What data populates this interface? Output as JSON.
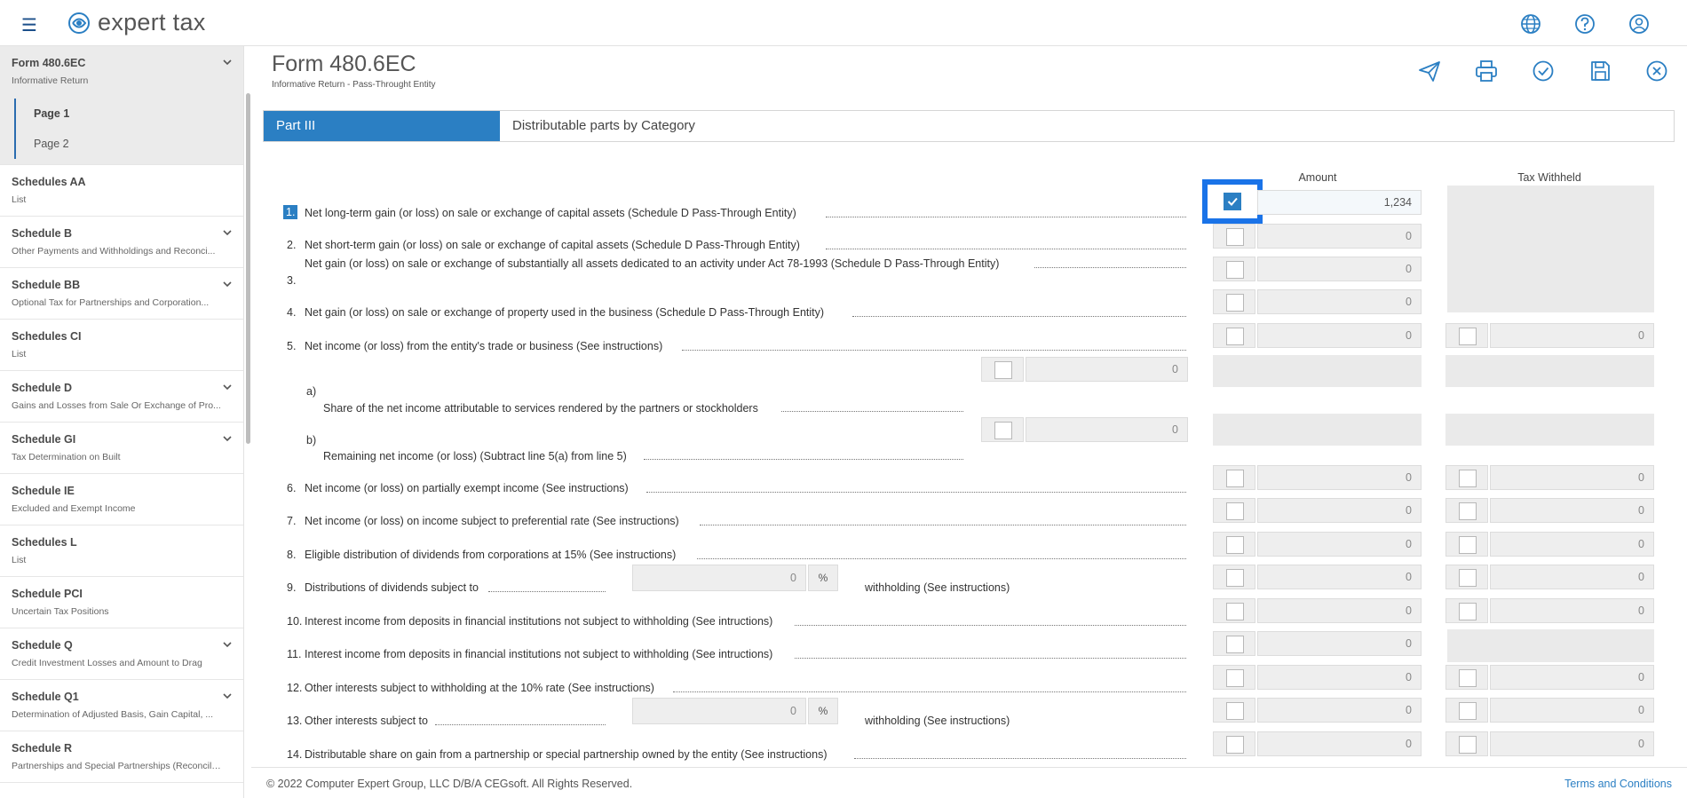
{
  "app": {
    "logo_text": "expert tax",
    "brand_color": "#2b7fc3",
    "focus_color": "#1a73e8"
  },
  "top_icons": [
    "globe-icon",
    "help-icon",
    "user-icon"
  ],
  "sidebar": {
    "items": [
      {
        "title": "Form 480.6EC",
        "sub": "Informative Return",
        "chevron": true,
        "active": true,
        "pages": [
          {
            "label": "Page 1",
            "active": true
          },
          {
            "label": "Page 2",
            "active": false
          }
        ]
      },
      {
        "title": "Schedules AA",
        "sub": "List",
        "chevron": false
      },
      {
        "title": "Schedule B",
        "sub": "Other Payments and Withholdings and Reconci...",
        "chevron": true
      },
      {
        "title": "Schedule BB",
        "sub": "Optional Tax for Partnerships and Corporation...",
        "chevron": true
      },
      {
        "title": "Schedules CI",
        "sub": "List",
        "chevron": false
      },
      {
        "title": "Schedule D",
        "sub": "Gains and Losses from Sale Or Exchange of Pro...",
        "chevron": true
      },
      {
        "title": "Schedule GI",
        "sub": "Tax Determination on Built",
        "chevron": true
      },
      {
        "title": "Schedule IE",
        "sub": "Excluded and Exempt Income",
        "chevron": false
      },
      {
        "title": "Schedules L",
        "sub": "List",
        "chevron": false
      },
      {
        "title": "Schedule PCI",
        "sub": "Uncertain Tax Positions",
        "chevron": false
      },
      {
        "title": "Schedule Q",
        "sub": "Credit Investment Losses and Amount to Drag",
        "chevron": true
      },
      {
        "title": "Schedule Q1",
        "sub": "Determination of Adjusted Basis, Gain Capital, ...",
        "chevron": true
      },
      {
        "title": "Schedule R",
        "sub": "Partnerships and Special Partnerships (Reconciliati...",
        "chevron": false
      }
    ]
  },
  "header": {
    "title": "Form 480.6EC",
    "subtitle": "Informative Return - Pass-Throught Entity",
    "actions": [
      "send-icon",
      "print-icon",
      "validate-icon",
      "save-icon",
      "close-icon"
    ]
  },
  "tabs": [
    {
      "label": "Part III",
      "active": true
    },
    {
      "label": "Distributable parts by Category",
      "active": false
    }
  ],
  "columns": {
    "amount": "Amount",
    "withheld": "Tax Withheld"
  },
  "rows": {
    "r1": {
      "num": "1.",
      "label": "Net long-term gain (or loss) on sale or exchange of capital assets (Schedule D Pass-Through Entity)",
      "amount": "1,234",
      "checked": true
    },
    "r2": {
      "num": "2.",
      "label": "Net short-term gain (or loss) on sale or exchange of capital assets (Schedule D Pass-Through Entity)",
      "amount": "0"
    },
    "r3": {
      "num": "3.",
      "label": "Net gain (or loss) on sale or exchange of substantially all assets dedicated to an activity under Act 78-1993 (Schedule D Pass-Through Entity)",
      "amount": "0",
      "amount_b": "0"
    },
    "r4": {
      "num": "4.",
      "label": "Net gain (or loss) on sale or exchange of property used in the business (Schedule D Pass-Through Entity)",
      "amount": "0"
    },
    "r5": {
      "num": "5.",
      "label": "Net income (or loss) from the entity's trade or business (See instructions)",
      "amount": "0",
      "withheld": "0"
    },
    "r5a": {
      "num": "a)",
      "label": "Share of the net income attributable to services rendered by the partners or stockholders",
      "value": "0"
    },
    "r5b": {
      "num": "b)",
      "label": "Remaining net income (or loss) (Subtract line 5(a) from line 5)",
      "value": "0"
    },
    "r6": {
      "num": "6.",
      "label": "Net income (or loss) on partially exempt income (See instructions)",
      "amount": "0",
      "withheld": "0"
    },
    "r7": {
      "num": "7.",
      "label": "Net income (or loss) on income subject to preferential rate (See instructions)",
      "amount": "0",
      "withheld": "0"
    },
    "r8": {
      "num": "8.",
      "label": "Eligible distribution of dividends from corporations at 15% (See instructions)",
      "amount": "0",
      "withheld": "0"
    },
    "r9": {
      "num": "9.",
      "label": "Distributions of dividends subject to",
      "rate": "0",
      "pct": "%",
      "suffix": "withholding (See instructions)",
      "amount": "0",
      "withheld": "0"
    },
    "r10": {
      "num": "10.",
      "label": "Interest income from deposits in financial institutions not subject to withholding (See intructions)",
      "amount": "0",
      "withheld": "0"
    },
    "r11": {
      "num": "11.",
      "label": "Interest income from deposits in financial institutions not subject to withholding (See intructions)",
      "amount": "0"
    },
    "r12": {
      "num": "12.",
      "label": "Other interests subject to withholding at the 10% rate (See instructions)",
      "amount": "0",
      "withheld": "0"
    },
    "r13": {
      "num": "13.",
      "label": "Other interests subject to",
      "rate": "0",
      "pct": "%",
      "suffix": "withholding (See instructions)",
      "amount": "0",
      "withheld": "0"
    },
    "r14": {
      "num": "14.",
      "label": "Distributable share on gain from a partnership or special partnership owned by the entity (See instructions)",
      "amount": "0",
      "withheld": "0"
    }
  },
  "footer": {
    "copyright": "© 2022 Computer Expert Group, LLC D/B/A CEGsoft. All Rights Reserved.",
    "terms": "Terms and Conditions"
  }
}
